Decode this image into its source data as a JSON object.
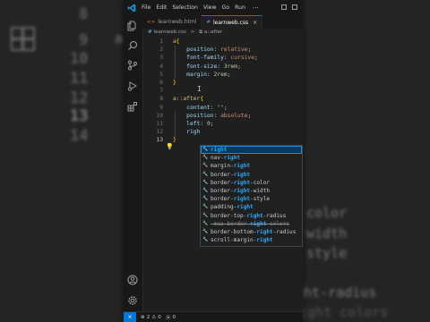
{
  "background_zoom": {
    "left_line_numbers": [
      "8",
      "9",
      "10",
      "11",
      "12",
      "13",
      "14"
    ],
    "left_code": [
      "a{"
    ],
    "right_code": [
      "color",
      "width",
      "style",
      "ght-radius",
      "ight colors"
    ]
  },
  "titlebar": {
    "menus": [
      "File",
      "Edit",
      "Selection",
      "View",
      "Go",
      "Run"
    ],
    "more": "···"
  },
  "tabs": [
    {
      "icon": "<>",
      "label": "learnweb.html",
      "active": false
    },
    {
      "icon": "#",
      "label": "learnweb.css",
      "active": true
    }
  ],
  "breadcrumb": {
    "file_icon": "#",
    "file": "learnweb.css",
    "separator": ">",
    "symbol_icon": "⧉",
    "symbol": "a::after"
  },
  "editor": {
    "current_line": 13,
    "lines": [
      {
        "n": "1",
        "tokens": [
          {
            "t": "a",
            "c": "sel"
          },
          {
            "t": "{",
            "c": "brace"
          }
        ]
      },
      {
        "n": "2",
        "tokens": [
          {
            "t": "    position",
            "c": "prop"
          },
          {
            "t": ": ",
            "c": "punct"
          },
          {
            "t": "relative",
            "c": "val"
          },
          {
            "t": ";",
            "c": "punct"
          }
        ]
      },
      {
        "n": "3",
        "tokens": [
          {
            "t": "    font-family",
            "c": "prop"
          },
          {
            "t": ": ",
            "c": "punct"
          },
          {
            "t": "cursive",
            "c": "val"
          },
          {
            "t": ";",
            "c": "punct"
          }
        ]
      },
      {
        "n": "4",
        "tokens": [
          {
            "t": "    font-size",
            "c": "prop"
          },
          {
            "t": ": ",
            "c": "punct"
          },
          {
            "t": "3rem",
            "c": "num"
          },
          {
            "t": ";",
            "c": "punct"
          }
        ]
      },
      {
        "n": "5",
        "tokens": [
          {
            "t": "    margin",
            "c": "prop"
          },
          {
            "t": ": ",
            "c": "punct"
          },
          {
            "t": "2rem",
            "c": "num"
          },
          {
            "t": ";",
            "c": "punct"
          }
        ]
      },
      {
        "n": "6",
        "tokens": [
          {
            "t": "}",
            "c": "brace"
          }
        ]
      },
      {
        "n": "7",
        "tokens": []
      },
      {
        "n": "8",
        "tokens": [
          {
            "t": "a::after",
            "c": "sel"
          },
          {
            "t": "{",
            "c": "brace"
          }
        ]
      },
      {
        "n": "9",
        "tokens": [
          {
            "t": "    content",
            "c": "prop"
          },
          {
            "t": ": ",
            "c": "punct"
          },
          {
            "t": "\"\"",
            "c": "val"
          },
          {
            "t": ";",
            "c": "punct"
          }
        ]
      },
      {
        "n": "10",
        "tokens": [
          {
            "t": "    position",
            "c": "prop"
          },
          {
            "t": ": ",
            "c": "punct"
          },
          {
            "t": "absolute",
            "c": "val"
          },
          {
            "t": ";",
            "c": "punct"
          }
        ]
      },
      {
        "n": "11",
        "tokens": [
          {
            "t": "    left",
            "c": "prop"
          },
          {
            "t": ": ",
            "c": "punct"
          },
          {
            "t": "0",
            "c": "num"
          },
          {
            "t": ";",
            "c": "punct"
          }
        ]
      },
      {
        "n": "12",
        "tokens": [
          {
            "t": "    righ",
            "c": "prop"
          }
        ]
      },
      {
        "n": "13",
        "tokens": [
          {
            "t": "}",
            "c": "brace"
          }
        ]
      }
    ]
  },
  "suggestions": [
    {
      "pre": "",
      "hl": "right",
      "post": "",
      "selected": true
    },
    {
      "pre": "nav-",
      "hl": "right",
      "post": ""
    },
    {
      "pre": "margin-",
      "hl": "right",
      "post": ""
    },
    {
      "pre": "border-",
      "hl": "right",
      "post": ""
    },
    {
      "pre": "border-",
      "hl": "right",
      "post": "-color"
    },
    {
      "pre": "border-",
      "hl": "right",
      "post": "-width"
    },
    {
      "pre": "border-",
      "hl": "right",
      "post": "-style"
    },
    {
      "pre": "padding-",
      "hl": "right",
      "post": ""
    },
    {
      "pre": "border-top-",
      "hl": "right",
      "post": "-radius"
    },
    {
      "pre": "-moz-border-",
      "hl": "right",
      "post": "-colors",
      "deprecated": true
    },
    {
      "pre": "border-bottom-",
      "hl": "right",
      "post": "-radius"
    },
    {
      "pre": "scroll-margin-",
      "hl": "right",
      "post": ""
    }
  ],
  "statusbar": {
    "remote_icon": "⨯",
    "errors": "2",
    "warnings": "0",
    "ports": "0"
  },
  "colors": {
    "accent": "#0078d4",
    "selection": "#04395e",
    "match_highlight": "#2aaaff"
  }
}
